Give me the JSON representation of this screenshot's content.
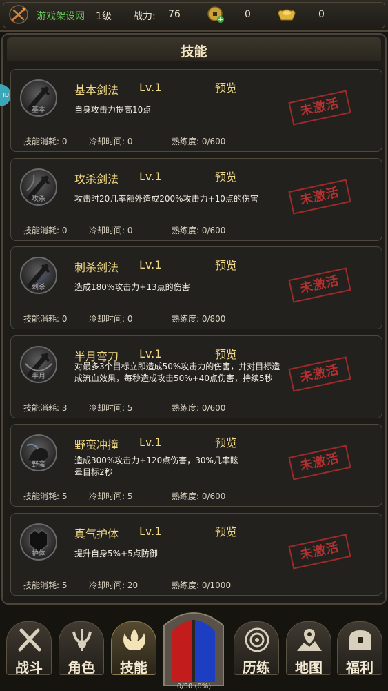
{
  "topbar": {
    "site_name": "游戏架设网",
    "level": "1级",
    "power_label": "战力:",
    "power_value": "76",
    "coins": "0",
    "ingots": "0"
  },
  "panel": {
    "title": "技能",
    "side_tab": "ID"
  },
  "skills": [
    {
      "icon_tag": "基本",
      "name": "基本剑法",
      "level": "Lv.1",
      "preview": "预览",
      "desc": "自身攻击力提高10点",
      "stamp": "未激活",
      "cost": "技能消耗:  0",
      "cooldown": "冷却时间:  0",
      "mastery": "熟练度:  0/600"
    },
    {
      "icon_tag": "攻杀",
      "name": "攻杀剑法",
      "level": "Lv.1",
      "preview": "预览",
      "desc": "攻击时20几率额外造成200%攻击力+10点的伤害",
      "stamp": "未激活",
      "cost": "技能消耗:  0",
      "cooldown": "冷却时间:  0",
      "mastery": "熟练度:  0/600"
    },
    {
      "icon_tag": "刺杀",
      "name": "刺杀剑法",
      "level": "Lv.1",
      "preview": "预览",
      "desc": "造成180%攻击力+13点的伤害",
      "stamp": "未激活",
      "cost": "技能消耗:  0",
      "cooldown": "冷却时间:  0",
      "mastery": "熟练度:  0/800"
    },
    {
      "icon_tag": "半月",
      "name": "半月弯刀",
      "level": "Lv.1",
      "preview": "预览",
      "desc": "对最多3个目标立即造成50%攻击力的伤害，并对目标造成流血效果，每秒造成攻击50%+40点伤害，持续5秒",
      "stamp": "未激活",
      "cost": "技能消耗:  3",
      "cooldown": "冷却时间:  5",
      "mastery": "熟练度:  0/600"
    },
    {
      "icon_tag": "野蛮",
      "name": "野蛮冲撞",
      "level": "Lv.1",
      "preview": "预览",
      "desc": "造成300%攻击力+120点伤害，30%几率眩晕目标2秒",
      "stamp": "未激活",
      "cost": "技能消耗:  5",
      "cooldown": "冷却时间:  5",
      "mastery": "熟练度:  0/600"
    },
    {
      "icon_tag": "护体",
      "name": "真气护体",
      "level": "Lv.1",
      "preview": "预览",
      "desc": "提升自身5%+5点防御",
      "stamp": "未激活",
      "cost": "技能消耗:  5",
      "cooldown": "冷却时间:  20",
      "mastery": "熟练度:  0/1000"
    }
  ],
  "nav": {
    "items": [
      {
        "label": "战斗",
        "icon": "crossed-swords-icon"
      },
      {
        "label": "角色",
        "icon": "trident-crest-icon"
      },
      {
        "label": "技能",
        "icon": "flame-crest-icon",
        "active": true
      },
      {
        "label": "历练",
        "icon": "swirl-icon"
      },
      {
        "label": "地图",
        "icon": "map-pin-icon"
      },
      {
        "label": "福利",
        "icon": "treasure-chest-icon"
      }
    ],
    "exp_text": "0/50 (0%)"
  },
  "colors": {
    "accent_gold": "#f1d985",
    "stamp_red": "#b33131",
    "site_green": "#63c95a"
  }
}
